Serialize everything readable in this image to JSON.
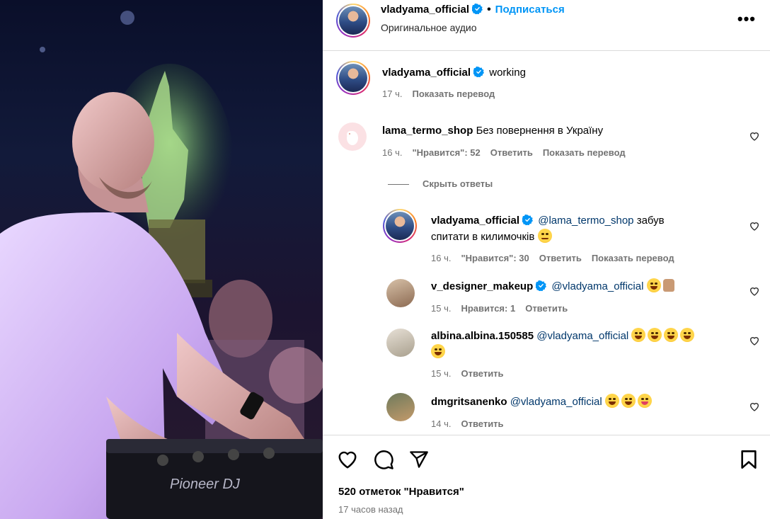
{
  "header": {
    "username": "vladyama_official",
    "separator": "•",
    "follow_label": "Подписаться",
    "audio_label": "Оригинальное аудио",
    "more_label": "•••"
  },
  "caption": {
    "username": "vladyama_official",
    "text": "working",
    "time": "17 ч.",
    "translate": "Показать перевод"
  },
  "comments": [
    {
      "username": "lama_termo_shop",
      "text": "Без повернення в Україну",
      "time": "16 ч.",
      "likes": "\"Нравится\": 52",
      "reply": "Ответить",
      "translate": "Показать перевод"
    }
  ],
  "hide_replies": "Скрыть ответы",
  "replies": [
    {
      "username": "vladyama_official",
      "mention": "@lama_termo_shop",
      "text_line1": "забув",
      "text_line2": "спитати в килимочків",
      "time": "16 ч.",
      "likes": "\"Нравится\": 30",
      "reply": "Ответить",
      "translate": "Показать перевод"
    },
    {
      "username": "v_designer_makeup",
      "mention": "@vladyama_official",
      "time": "15 ч.",
      "likes": "Нравится: 1",
      "reply": "Ответить"
    },
    {
      "username": "albina.albina.150585",
      "mention": "@vladyama_official",
      "time": "15 ч.",
      "reply": "Ответить"
    },
    {
      "username": "dmgritsanenko",
      "mention": "@vladyama_official",
      "time": "14 ч.",
      "reply": "Ответить"
    }
  ],
  "footer": {
    "likes_count": "520 отметок \"Нравится\"",
    "posted": "17 часов назад"
  },
  "colors": {
    "accent": "#0095f6",
    "verified": "#0095f6",
    "mention": "#00376b",
    "muted": "#737373"
  }
}
